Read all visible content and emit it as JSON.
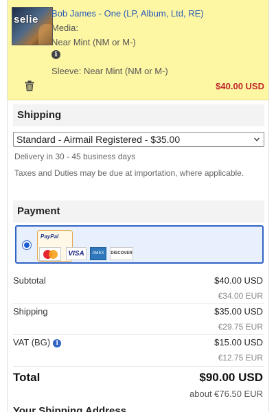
{
  "cart_item": {
    "cover_text": "selie",
    "title": "Bob James - One (LP, Album, Ltd, RE)",
    "media_label": "Media:",
    "media_condition": "Near Mint (NM or M-)",
    "sleeve": "Sleeve: Near Mint (NM or M-)",
    "price": "$40.00 USD",
    "info_icon": "info-icon",
    "remove_icon": "trash-icon"
  },
  "shipping": {
    "heading": "Shipping",
    "selected_option": "Standard - Airmail Registered - $35.00",
    "delivery": "Delivery in 30 - 45 business days",
    "taxes_note": "Taxes and Duties may be due at importation, where applicable."
  },
  "payment": {
    "heading": "Payment",
    "method_selected": true,
    "paypal_label": "PayPal",
    "card_logos": [
      "MasterCard",
      "VISA",
      "AMEX",
      "DISCOVER"
    ]
  },
  "summary": {
    "rows": [
      {
        "label": "Subtotal",
        "usd": "$40.00 USD",
        "eur": "€34.00 EUR"
      },
      {
        "label": "Shipping",
        "usd": "$35.00 USD",
        "eur": "€29.75 EUR"
      },
      {
        "label": "VAT (BG)",
        "usd": "$15.00 USD",
        "eur": "€12.75 EUR"
      }
    ],
    "total_label": "Total",
    "total_usd": "$90.00 USD",
    "total_eur": "about €76.50 EUR"
  },
  "next_section_heading": "Your Shipping Address",
  "colors": {
    "item_background": "#fdf6a3",
    "title_link": "#2a5bb8",
    "price_red": "#c0272d",
    "payment_border": "#2f63c4"
  }
}
